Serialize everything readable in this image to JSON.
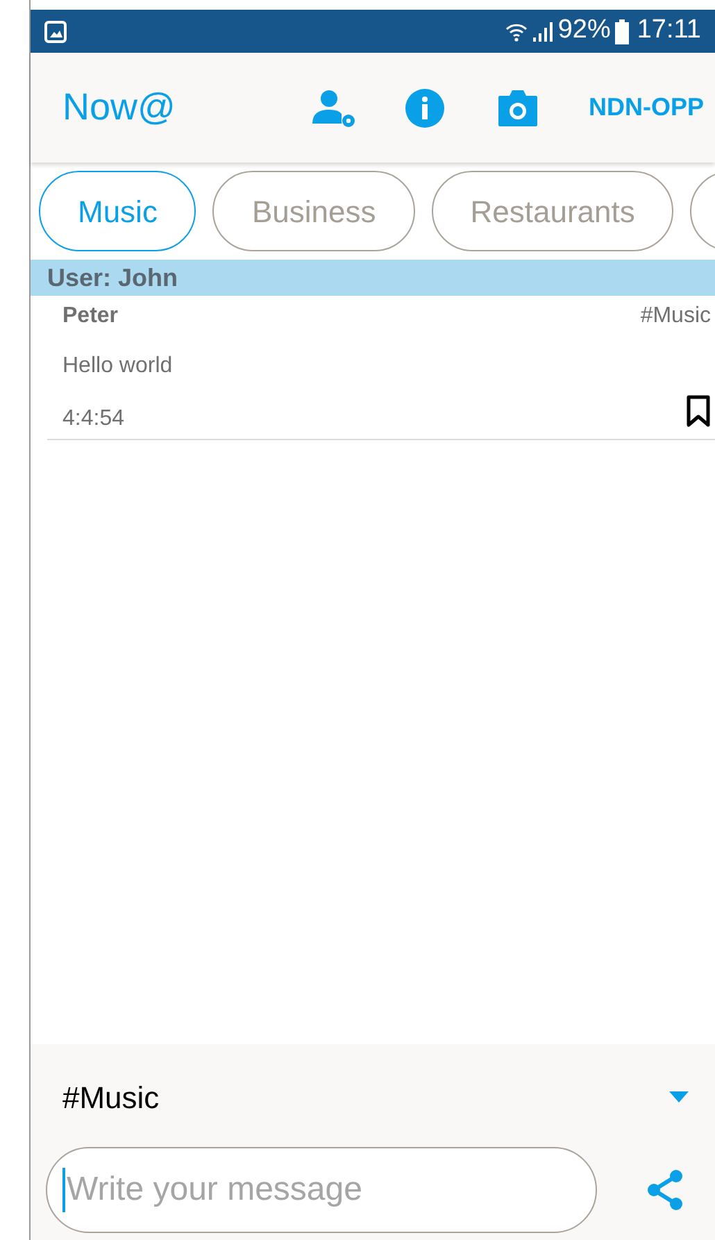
{
  "status_bar": {
    "battery": "92%",
    "time": "17:11"
  },
  "header": {
    "title": "Now@",
    "action": "NDN-OPP"
  },
  "chips": [
    {
      "label": "Music",
      "selected": true
    },
    {
      "label": "Business",
      "selected": false
    },
    {
      "label": "Restaurants",
      "selected": false
    }
  ],
  "user_bar": "User: John",
  "messages": [
    {
      "sender": "Peter",
      "tag": "#Music",
      "text": "Hello world",
      "time": "4:4:54",
      "bookmarked": false
    }
  ],
  "composer": {
    "topic": "#Music",
    "placeholder": "Write your message"
  }
}
